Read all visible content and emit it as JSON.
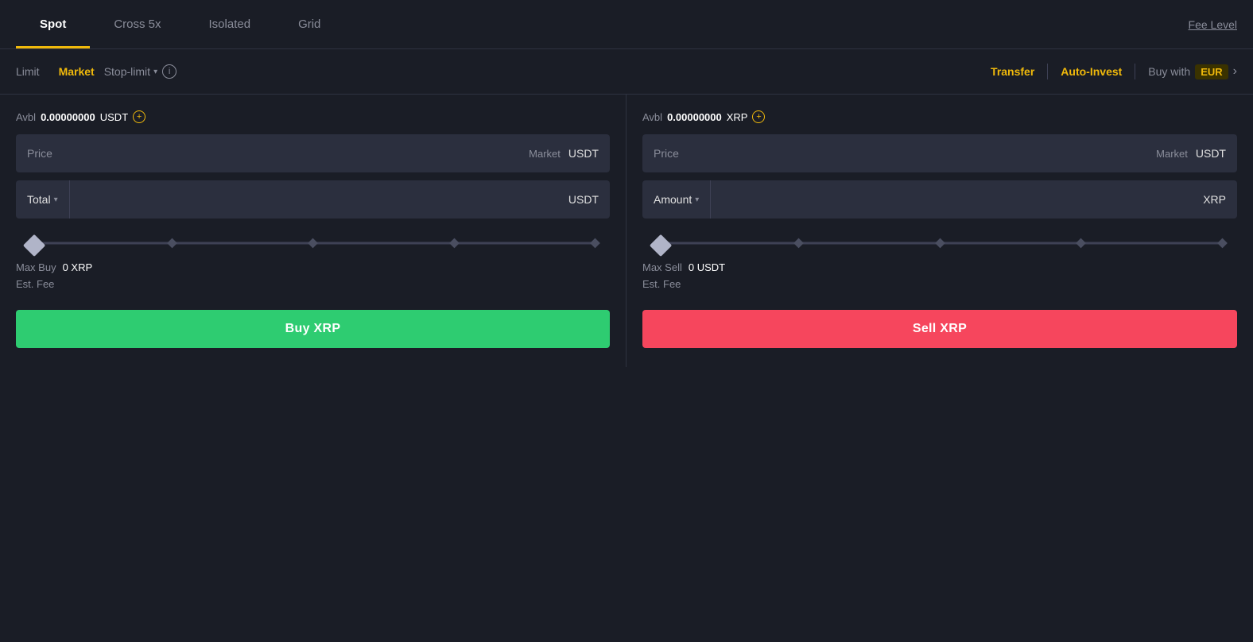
{
  "tabs": [
    {
      "id": "spot",
      "label": "Spot",
      "active": true
    },
    {
      "id": "cross5x",
      "label": "Cross 5x",
      "active": false
    },
    {
      "id": "isolated",
      "label": "Isolated",
      "active": false
    },
    {
      "id": "grid",
      "label": "Grid",
      "active": false
    }
  ],
  "fee_level": "Fee Level",
  "order_types": [
    {
      "id": "limit",
      "label": "Limit",
      "active": false
    },
    {
      "id": "market",
      "label": "Market",
      "active": true
    },
    {
      "id": "stop_limit",
      "label": "Stop-limit",
      "active": false
    }
  ],
  "right_actions": {
    "transfer": "Transfer",
    "auto_invest": "Auto-Invest",
    "buy_with": "Buy with",
    "currency": "EUR"
  },
  "buy_panel": {
    "avbl_label": "Avbl",
    "avbl_amount": "0.00000000",
    "avbl_currency": "USDT",
    "price_label": "Price",
    "price_market": "Market",
    "price_currency": "USDT",
    "total_label": "Total",
    "total_arrow": "▾",
    "total_currency": "USDT",
    "max_buy_label": "Max Buy",
    "max_buy_value": "0 XRP",
    "est_fee_label": "Est. Fee",
    "est_fee_value": "",
    "button_label": "Buy XRP"
  },
  "sell_panel": {
    "avbl_label": "Avbl",
    "avbl_amount": "0.00000000",
    "avbl_currency": "XRP",
    "price_label": "Price",
    "price_market": "Market",
    "price_currency": "USDT",
    "amount_label": "Amount",
    "amount_arrow": "▾",
    "amount_currency": "XRP",
    "max_sell_label": "Max Sell",
    "max_sell_value": "0 USDT",
    "est_fee_label": "Est. Fee",
    "est_fee_value": "",
    "button_label": "Sell XRP"
  },
  "colors": {
    "accent": "#f0b90b",
    "buy": "#2ecc71",
    "sell": "#f6465d",
    "bg": "#1a1d26",
    "input_bg": "#2b2f3e",
    "border": "#2e3240"
  }
}
